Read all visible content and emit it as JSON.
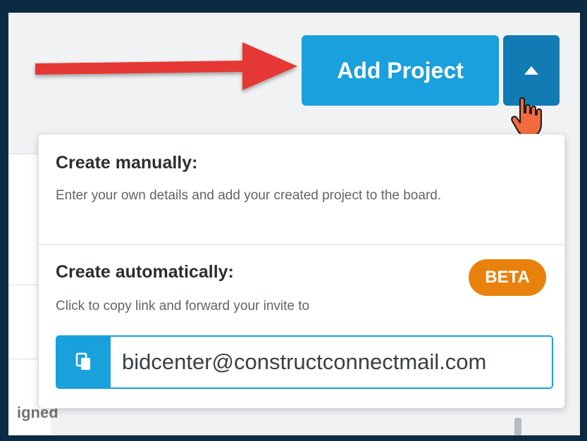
{
  "header": {
    "add_project_label": "Add Project",
    "toggle_icon": "caret-up-icon"
  },
  "dropdown": {
    "manual": {
      "title": "Create manually:",
      "description": "Enter your own details and add your created project to the board."
    },
    "automatic": {
      "title": "Create automatically:",
      "badge": "BETA",
      "description": "Click to copy link and forward your invite to",
      "email_value": "bidcenter@constructconnectmail.com",
      "copy_icon": "copy-icon"
    }
  },
  "background": {
    "partial_text": "igned"
  },
  "colors": {
    "primary": "#1aa0dc",
    "primary_dark": "#137bb3",
    "badge": "#e8820c",
    "annotation_arrow": "#e53935"
  }
}
